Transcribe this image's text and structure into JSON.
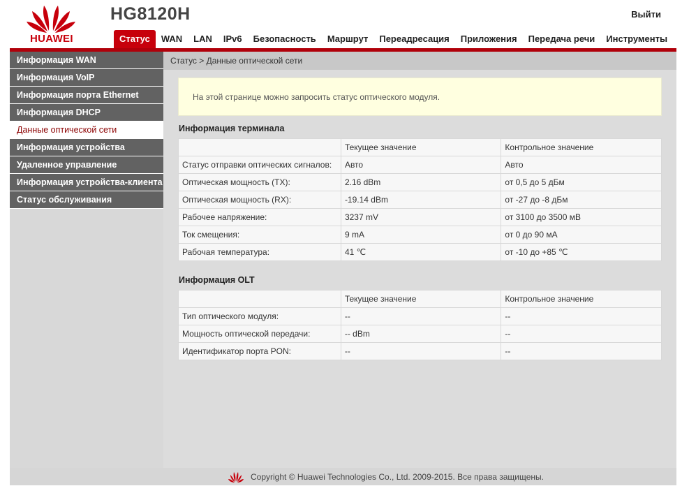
{
  "header": {
    "brand": "HUAWEI",
    "model": "HG8120H",
    "logout_label": "Выйти"
  },
  "nav": {
    "items": [
      {
        "label": "Статус",
        "active": true
      },
      {
        "label": "WAN"
      },
      {
        "label": "LAN"
      },
      {
        "label": "IPv6"
      },
      {
        "label": "Безопасность"
      },
      {
        "label": "Маршрут"
      },
      {
        "label": "Переадресация"
      },
      {
        "label": "Приложения"
      },
      {
        "label": "Передача речи"
      },
      {
        "label": "Инструменты"
      }
    ]
  },
  "sidebar": {
    "items": [
      {
        "label": "Информация WAN"
      },
      {
        "label": "Информация VoIP"
      },
      {
        "label": "Информация порта Ethernet"
      },
      {
        "label": "Информация DHCP"
      },
      {
        "label": "Данные оптической сети",
        "active": true
      },
      {
        "label": "Информация устройства"
      },
      {
        "label": "Удаленное управление"
      },
      {
        "label": "Информация устройства-клиента"
      },
      {
        "label": "Статус обслуживания"
      }
    ]
  },
  "main": {
    "breadcrumb": "Статус > Данные оптической сети",
    "notice": "На этой странице можно запросить статус оптического модуля.",
    "terminal": {
      "title": "Информация терминала",
      "header": [
        "",
        "Текущее значение",
        "Контрольное значение"
      ],
      "rows": [
        [
          "Статус отправки оптических сигналов:",
          "Авто",
          "Авто"
        ],
        [
          "Оптическая мощность (TX):",
          "2.16 dBm",
          "от 0,5 до 5 дБм"
        ],
        [
          "Оптическая мощность (RX):",
          "-19.14 dBm",
          "от -27 до -8 дБм"
        ],
        [
          "Рабочее напряжение:",
          "3237 mV",
          "от 3100 до 3500 мВ"
        ],
        [
          "Ток смещения:",
          "9 mA",
          "от 0 до 90 мА"
        ],
        [
          "Рабочая температура:",
          "41 ℃",
          "от -10 до +85 ℃"
        ]
      ]
    },
    "olt": {
      "title": "Информация OLT",
      "header": [
        "",
        "Текущее значение",
        "Контрольное значение"
      ],
      "rows": [
        [
          "Тип оптического модуля:",
          "--",
          "--"
        ],
        [
          "Мощность оптической передачи:",
          "-- dBm",
          "--"
        ],
        [
          "Идентификатор порта PON:",
          "--",
          "--"
        ]
      ]
    }
  },
  "footer": {
    "copyright": "Copyright © Huawei Technologies Co., Ltd. 2009-2015. Все права защищены."
  },
  "colors": {
    "brand_red": "#c7000b",
    "sidebar_bg": "#626262",
    "notice_bg": "#ffffe0"
  }
}
